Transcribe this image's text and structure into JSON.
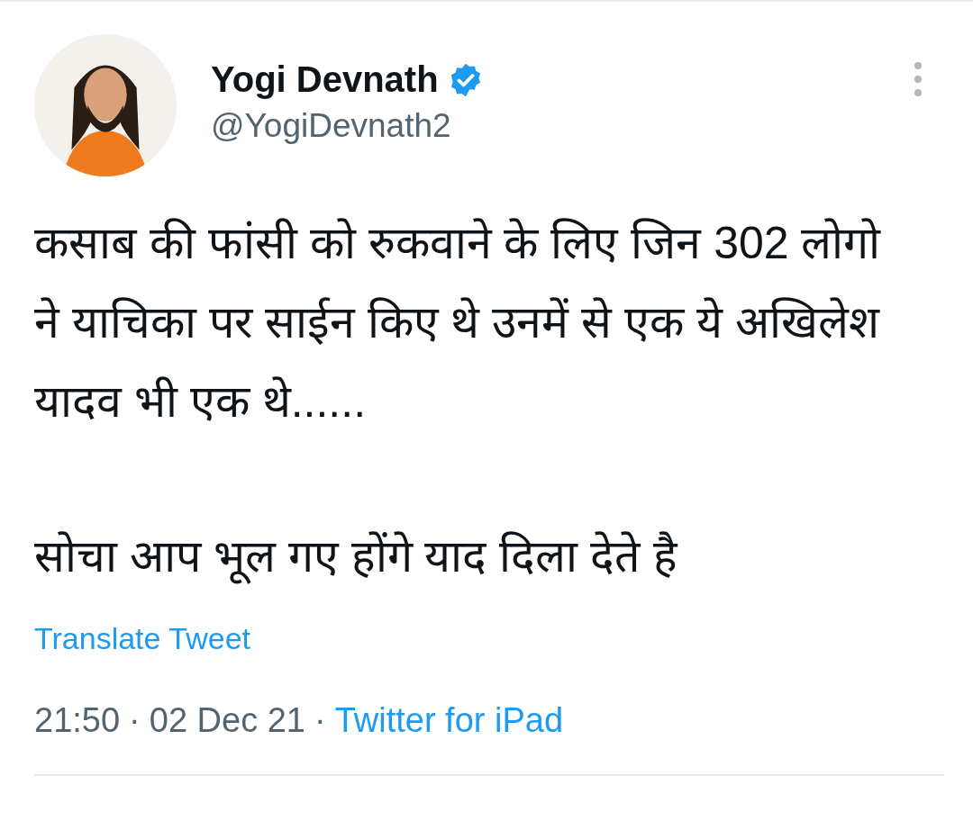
{
  "author": {
    "name": "Yogi Devnath",
    "handle": "@YogiDevnath2",
    "verified": true
  },
  "tweet": {
    "paragraphs": [
      "कसाब की फांसी को रुकवाने के लिए जिन 302 लोगो ने याचिका पर साईन किए थे उनमें से एक ये अखिलेश यादव भी एक थे......",
      "सोचा आप भूल गए होंगे याद दिला देते है"
    ],
    "translate_link": "Translate Tweet",
    "time": "21:50",
    "separator": "·",
    "date": "02 Dec 21",
    "source": "Twitter for iPad"
  }
}
